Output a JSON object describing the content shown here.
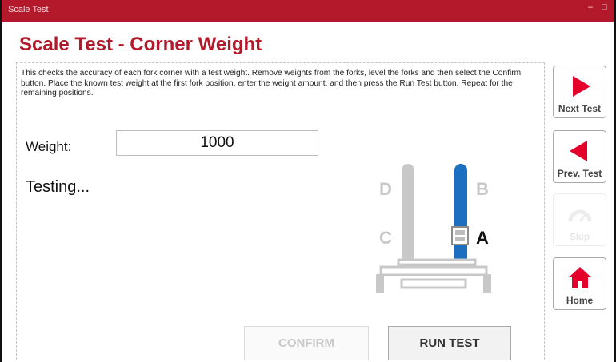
{
  "window": {
    "title": "Scale Test",
    "minimize_glyph": "–",
    "maximize_glyph": "□"
  },
  "page": {
    "heading": "Scale Test - Corner Weight",
    "description": "This checks the accuracy of each fork corner with a test weight. Remove weights from the forks, level the forks and then select the Confirm button. Place the known test weight at the first fork position, enter the weight amount, and then press the Run Test button. Repeat for the remaining positions.",
    "weight_label": "Weight:",
    "weight_value": "1000",
    "status": "Testing..."
  },
  "diagram": {
    "labels": {
      "a": "A",
      "b": "B",
      "c": "C",
      "d": "D"
    },
    "active_fork_color": "#1a6fc0",
    "inactive_color": "#c8c8c8",
    "highlight_position": "A"
  },
  "actions": {
    "confirm_label": "CONFIRM",
    "confirm_enabled": false,
    "run_test_label": "RUN TEST"
  },
  "sidebar": {
    "next": {
      "label": "Next Test",
      "icon": "play-right-icon"
    },
    "prev": {
      "label": "Prev. Test",
      "icon": "play-left-icon"
    },
    "skip": {
      "label": "Skip",
      "icon": "gauge-icon",
      "enabled": false
    },
    "home": {
      "label": "Home",
      "icon": "home-icon"
    }
  },
  "colors": {
    "brand_red": "#b3192b",
    "icon_red": "#e4002b",
    "blue": "#1a6fc0"
  }
}
